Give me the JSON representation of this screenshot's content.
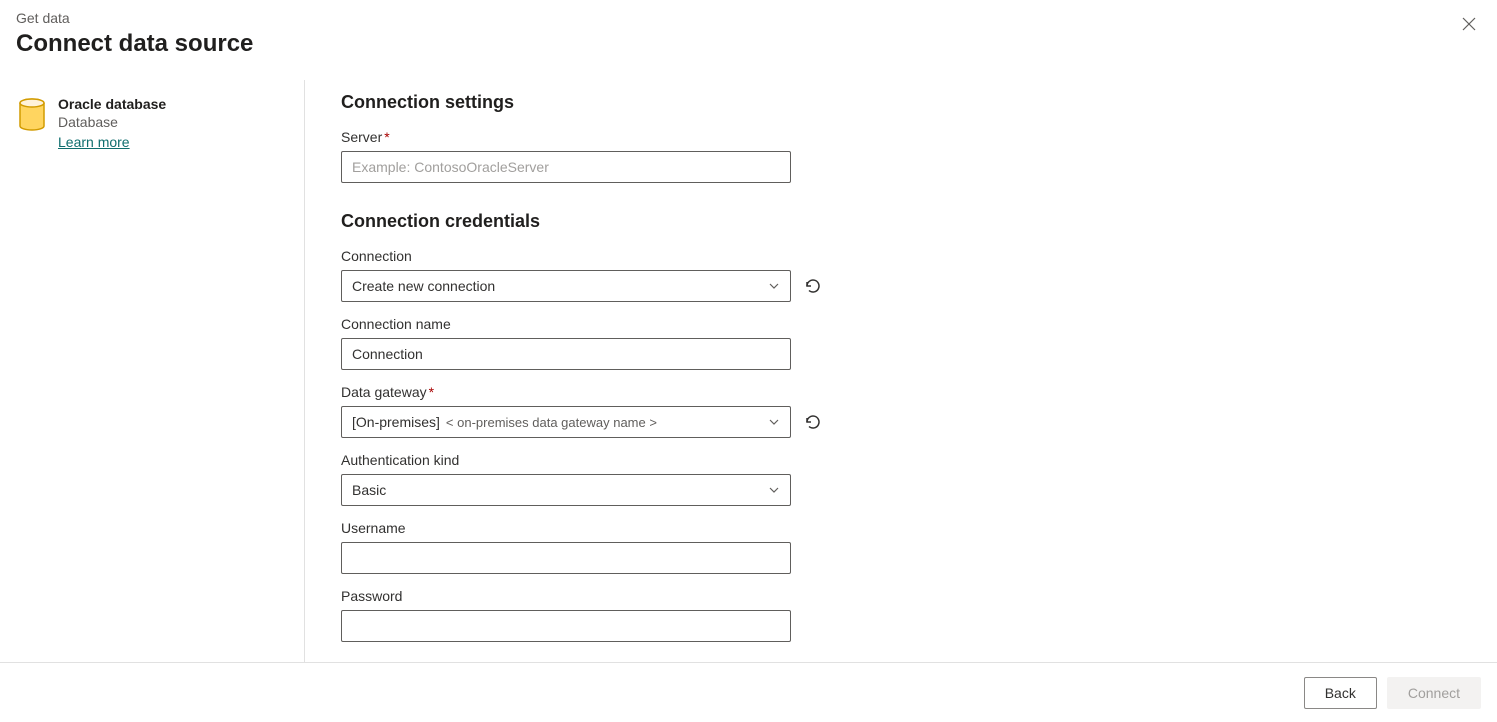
{
  "header": {
    "breadcrumb": "Get data",
    "title": "Connect data source"
  },
  "sidebar": {
    "source": {
      "name": "Oracle database",
      "type": "Database",
      "learn_more": "Learn more"
    }
  },
  "main": {
    "settings": {
      "title": "Connection settings",
      "server": {
        "label": "Server",
        "placeholder": "Example: ContosoOracleServer",
        "value": "",
        "required": true
      }
    },
    "credentials": {
      "title": "Connection credentials",
      "connection": {
        "label": "Connection",
        "value": "Create new connection"
      },
      "connection_name": {
        "label": "Connection name",
        "value": "Connection"
      },
      "gateway": {
        "label": "Data gateway",
        "prefix": "[On-premises]",
        "name": "< on-premises data gateway name >",
        "required": true
      },
      "auth": {
        "label": "Authentication kind",
        "value": "Basic"
      },
      "username": {
        "label": "Username",
        "value": ""
      },
      "password": {
        "label": "Password",
        "value": ""
      }
    }
  },
  "footer": {
    "back": "Back",
    "connect": "Connect"
  }
}
